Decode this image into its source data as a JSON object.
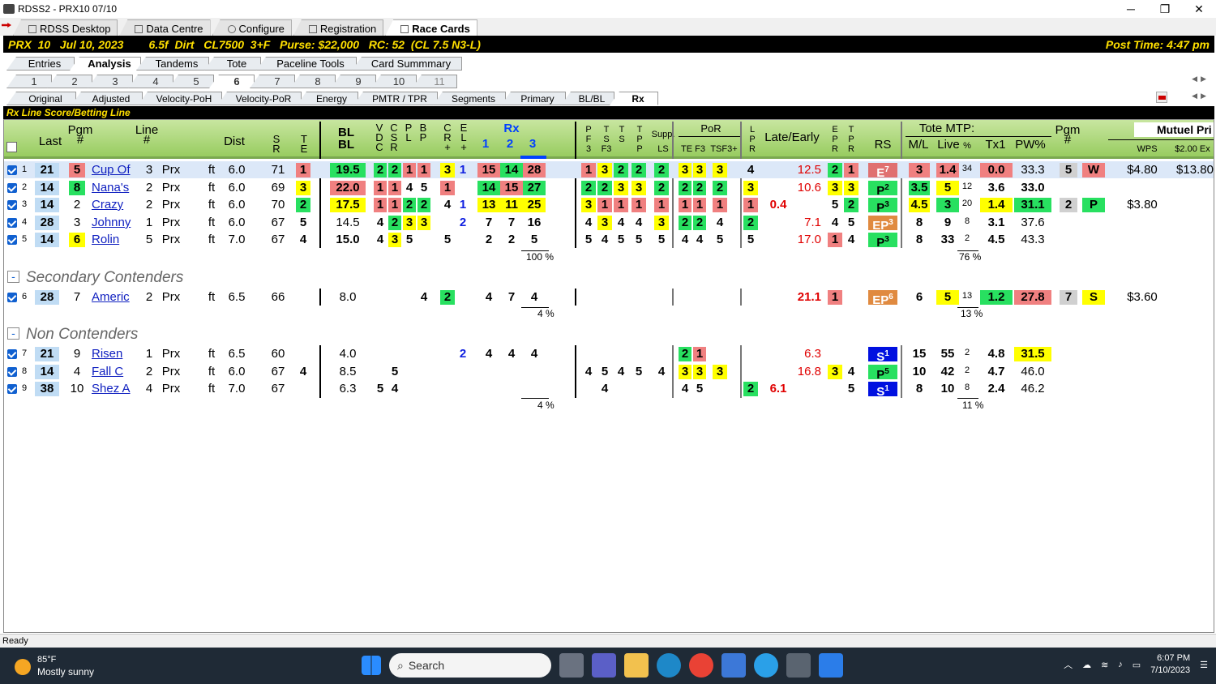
{
  "window": {
    "title": "RDSS2 - PRX10  07/10",
    "controls": [
      "─",
      "❐",
      "✕"
    ]
  },
  "toptabs": [
    {
      "label": "RDSS Desktop",
      "icon": "desktop-icon"
    },
    {
      "label": "Data Centre",
      "icon": "data-icon"
    },
    {
      "label": "Configure",
      "icon": "gear-icon"
    },
    {
      "label": "Registration",
      "icon": "registration-icon"
    },
    {
      "label": "Race Cards",
      "icon": "card-icon",
      "active": true
    }
  ],
  "race": {
    "info": "PRX  10   Jul 10, 2023        6.5f  Dirt   CL7500  3+F   Purse: $22,000   RC: 52  (CL 7.5 N3-L)",
    "post_time": "Post Time: 4:47 pm"
  },
  "main_tabs": [
    "Entries",
    "Analysis",
    "Tandems",
    "Tote",
    "Paceline Tools",
    "Card Summmary"
  ],
  "race_tabs": [
    "1",
    "2",
    "3",
    "4",
    "5",
    "6",
    "7",
    "8",
    "9",
    "10",
    "11"
  ],
  "sub_tabs": [
    "Original",
    "Adjusted",
    "Velocity-PoH",
    "Velocity-PoR",
    "Energy",
    "PMTR / TPR",
    "Segments",
    "Primary",
    "BL/BL",
    "Rx"
  ],
  "section_title": "Rx Line Score/Betting Line",
  "headers": {
    "last": "Last",
    "pgm": "Pgm\n#",
    "line": "Line\n#",
    "dist": "Dist",
    "sr": "S\nR",
    "te": "T\nE",
    "blbl": "BL\nBL",
    "vdc": "V\nD\nC",
    "csr": "C\nS\nR",
    "pl": "P\nL",
    "bp": "B\nP",
    "cr": "C\nR\n+",
    "el": "E\nL\n+",
    "rx": "Rx",
    "rx1": "1",
    "rx2": "2",
    "rx3": "3",
    "pf3": "P\nF\n3",
    "tsf3": "T\nS\nF3",
    "ts": "T\nS",
    "tpp": "T\nP\nP",
    "supp": "Supp.",
    "ls": "LS",
    "por": "PoR",
    "te_f3": "TE F3",
    "tsf3p": "TSF3+",
    "lpr": "L\nP\nR",
    "late_early": "Late/Early",
    "epr": "E\nP\nR",
    "tpr": "T\nP\nR",
    "rs": "RS",
    "tote": "Tote MTP:",
    "ml": "M/L",
    "live": "Live",
    "pct": "%",
    "tx1": "Tx1",
    "pw": "PW%",
    "pgm2": "Pgm\n#",
    "mutuel": "Mutuel Pri",
    "wps": "WPS",
    "ex": "$2.00 Ex"
  },
  "groups": [
    "Secondary Contenders",
    "Non Contenders"
  ],
  "rows": [
    {
      "n": "1",
      "last": "21",
      "pgm": "5",
      "name": "Cup Of",
      "line": "3",
      "trk": "Prx",
      "surf": "ft",
      "dist": "6.0",
      "sr": "71",
      "te": "1",
      "bl": "19.5",
      "vdc": "2",
      "csr": "2",
      "pl": "1",
      "bp": "1",
      "cr": "3",
      "el": "1",
      "rx1": "15",
      "rx2": "14",
      "rx3": "28",
      "pf3": "1",
      "tsf3": "3",
      "ts": "2",
      "tpp": "2",
      "ls": "2",
      "tef": "3",
      "f3": "3",
      "tsf": "3",
      "lpr": "4",
      "le1": "",
      "le2": "12.5",
      "epr": "2",
      "tpr": "1",
      "rs": "E",
      "rsn": "7",
      "ml": "3",
      "live": "1.4",
      "pct": "34",
      "tx1": "0.0",
      "pw": "33.3",
      "pgm2": "5",
      "pos": "W",
      "wps": "$4.80",
      "ex": "$13.80"
    },
    {
      "n": "2",
      "last": "14",
      "pgm": "8",
      "name": "Nana's",
      "line": "2",
      "trk": "Prx",
      "surf": "ft",
      "dist": "6.0",
      "sr": "69",
      "te": "3",
      "bl": "22.0",
      "vdc": "1",
      "csr": "1",
      "pl": "4",
      "bp": "5",
      "cr": "1",
      "el": "",
      "rx1": "14",
      "rx2": "15",
      "rx3": "27",
      "pf3": "2",
      "tsf3": "2",
      "ts": "3",
      "tpp": "3",
      "ls": "2",
      "tef": "2",
      "f3": "2",
      "tsf": "2",
      "lpr": "3",
      "le1": "",
      "le2": "10.6",
      "epr": "3",
      "tpr": "3",
      "rs": "P",
      "rsn": "2",
      "ml": "3.5",
      "live": "5",
      "pct": "12",
      "tx1": "3.6",
      "pw": "33.0",
      "pgm2": "",
      "pos": "",
      "wps": "",
      "ex": ""
    },
    {
      "n": "3",
      "last": "14",
      "pgm": "2",
      "name": "Crazy",
      "line": "2",
      "trk": "Prx",
      "surf": "ft",
      "dist": "6.0",
      "sr": "70",
      "te": "2",
      "bl": "17.5",
      "vdc": "1",
      "csr": "1",
      "pl": "2",
      "bp": "2",
      "cr": "4",
      "el": "1",
      "rx1": "13",
      "rx2": "11",
      "rx3": "25",
      "pf3": "3",
      "tsf3": "1",
      "ts": "1",
      "tpp": "1",
      "ls": "1",
      "tef": "1",
      "f3": "1",
      "tsf": "1",
      "lpr": "1",
      "le1": "0.4",
      "le2": "",
      "epr": "5",
      "tpr": "2",
      "rs": "P",
      "rsn": "3",
      "ml": "4.5",
      "live": "3",
      "pct": "20",
      "tx1": "1.4",
      "pw": "31.1",
      "pgm2": "2",
      "pos": "P",
      "wps": "$3.80",
      "ex": ""
    },
    {
      "n": "4",
      "last": "28",
      "pgm": "3",
      "name": "Johnny",
      "line": "1",
      "trk": "Prx",
      "surf": "ft",
      "dist": "6.0",
      "sr": "67",
      "te": "5",
      "bl": "14.5",
      "vdc": "4",
      "csr": "2",
      "pl": "3",
      "bp": "3",
      "cr": "",
      "el": "2",
      "rx1": "7",
      "rx2": "7",
      "rx3": "16",
      "pf3": "4",
      "tsf3": "3",
      "ts": "4",
      "tpp": "4",
      "ls": "3",
      "tef": "2",
      "f3": "2",
      "tsf": "4",
      "lpr": "2",
      "le1": "",
      "le2": "7.1",
      "epr": "4",
      "tpr": "5",
      "rs": "EP",
      "rsn": "3",
      "ml": "8",
      "live": "9",
      "pct": "8",
      "tx1": "3.1",
      "pw": "37.6",
      "pgm2": "",
      "pos": "",
      "wps": "",
      "ex": ""
    },
    {
      "n": "5",
      "last": "14",
      "pgm": "6",
      "name": "Rolin",
      "line": "5",
      "trk": "Prx",
      "surf": "ft",
      "dist": "7.0",
      "sr": "67",
      "te": "4",
      "bl": "15.0",
      "vdc": "4",
      "csr": "3",
      "pl": "5",
      "bp": "",
      "cr": "5",
      "el": "",
      "rx1": "2",
      "rx2": "2",
      "rx3": "5",
      "pf3": "5",
      "tsf3": "4",
      "ts": "5",
      "tpp": "5",
      "ls": "5",
      "tef": "4",
      "f3": "4",
      "tsf": "5",
      "lpr": "5",
      "le1": "",
      "le2": "17.0",
      "epr": "1",
      "tpr": "4",
      "rs": "P",
      "rsn": "3",
      "ml": "8",
      "live": "33",
      "pct": "2",
      "tx1": "4.5",
      "pw": "43.3",
      "pgm2": "",
      "pos": "",
      "wps": "",
      "ex": ""
    },
    {
      "n": "6",
      "last": "28",
      "pgm": "7",
      "name": "Americ",
      "line": "2",
      "trk": "Prx",
      "surf": "ft",
      "dist": "6.5",
      "sr": "66",
      "te": "",
      "bl": "8.0",
      "vdc": "",
      "csr": "",
      "pl": "",
      "bp": "4",
      "cr": "2",
      "el": "",
      "rx1": "4",
      "rx2": "7",
      "rx3": "4",
      "pf3": "",
      "tsf3": "",
      "ts": "",
      "tpp": "",
      "ls": "",
      "tef": "",
      "f3": "",
      "tsf": "",
      "lpr": "",
      "le1": "",
      "le2": "21.1",
      "epr": "1",
      "tpr": "",
      "rs": "EP",
      "rsn": "6",
      "ml": "6",
      "live": "5",
      "pct": "13",
      "tx1": "1.2",
      "pw": "27.8",
      "pgm2": "7",
      "pos": "S",
      "wps": "$3.60",
      "ex": ""
    },
    {
      "n": "7",
      "last": "21",
      "pgm": "9",
      "name": "Risen",
      "line": "1",
      "trk": "Prx",
      "surf": "ft",
      "dist": "6.5",
      "sr": "60",
      "te": "",
      "bl": "4.0",
      "vdc": "",
      "csr": "",
      "pl": "",
      "bp": "",
      "cr": "",
      "el": "2",
      "rx1": "4",
      "rx2": "4",
      "rx3": "4",
      "pf3": "",
      "tsf3": "",
      "ts": "",
      "tpp": "",
      "ls": "",
      "tef": "2",
      "f3": "1",
      "tsf": "",
      "lpr": "",
      "le1": "",
      "le2": "6.3",
      "epr": "",
      "tpr": "",
      "rs": "S",
      "rsn": "1",
      "ml": "15",
      "live": "55",
      "pct": "2",
      "tx1": "4.8",
      "pw": "31.5",
      "pgm2": "",
      "pos": "",
      "wps": "",
      "ex": ""
    },
    {
      "n": "8",
      "last": "14",
      "pgm": "4",
      "name": "Fall C",
      "line": "2",
      "trk": "Prx",
      "surf": "ft",
      "dist": "6.0",
      "sr": "67",
      "te": "4",
      "bl": "8.5",
      "vdc": "",
      "csr": "5",
      "pl": "",
      "bp": "",
      "cr": "",
      "el": "",
      "rx1": "",
      "rx2": "",
      "rx3": "",
      "pf3": "4",
      "tsf3": "5",
      "ts": "4",
      "tpp": "5",
      "ls": "4",
      "tef": "3",
      "f3": "3",
      "tsf": "3",
      "lpr": "",
      "le1": "",
      "le2": "16.8",
      "epr": "3",
      "tpr": "4",
      "rs": "P",
      "rsn": "5",
      "ml": "10",
      "live": "42",
      "pct": "2",
      "tx1": "4.7",
      "pw": "46.0",
      "pgm2": "",
      "pos": "",
      "wps": "",
      "ex": ""
    },
    {
      "n": "9",
      "last": "38",
      "pgm": "10",
      "name": "Shez A",
      "line": "4",
      "trk": "Prx",
      "surf": "ft",
      "dist": "7.0",
      "sr": "67",
      "te": "",
      "bl": "6.3",
      "vdc": "5",
      "csr": "4",
      "pl": "",
      "bp": "",
      "cr": "",
      "el": "",
      "rx1": "",
      "rx2": "",
      "rx3": "",
      "pf3": "",
      "tsf3": "4",
      "ts": "",
      "tpp": "",
      "ls": "",
      "tef": "4",
      "f3": "5",
      "tsf": "",
      "lpr": "2",
      "le1": "6.1",
      "le2": "",
      "epr": "",
      "tpr": "5",
      "rs": "S",
      "rsn": "1",
      "ml": "8",
      "live": "10",
      "pct": "8",
      "tx1": "2.4",
      "pw": "46.2",
      "pgm2": "",
      "pos": "",
      "wps": "",
      "ex": ""
    }
  ],
  "pcts": {
    "rx_g1": "100 %",
    "live_g1": "76 %",
    "rx_g2": "4 %",
    "live_g2": "13 %",
    "rx_g3": "4 %",
    "live_g3": "11 %"
  },
  "status": "Ready",
  "taskbar": {
    "temp": "85°F",
    "weather": "Mostly sunny",
    "search": "Search",
    "time": "6:07 PM",
    "date": "7/10/2023"
  }
}
